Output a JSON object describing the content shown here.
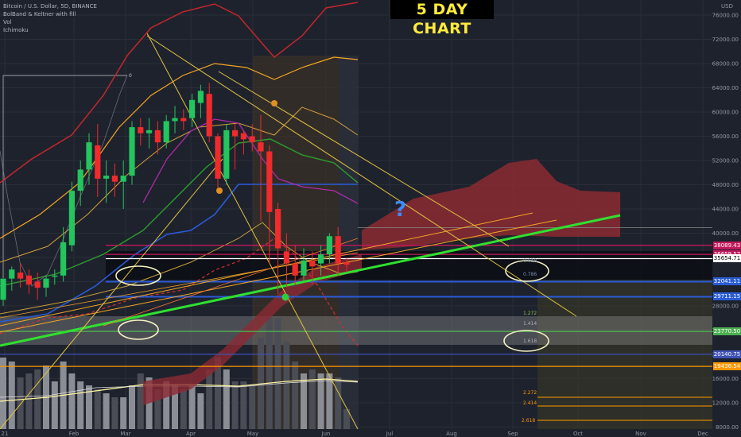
{
  "legend": {
    "symbol": "Bitcoin / U.S. Dollar, 5D, BINANCE",
    "ind1": "BolBand & Keltner with fill",
    "ind2": "Vol",
    "ind3": "Ichimoku"
  },
  "badge": "5 DAY CHART",
  "colors": {
    "background": "#1e222d",
    "up": "#22c55e",
    "down": "#ef2b2b",
    "trendline": "#30e030",
    "bb_outer": "#c2272d",
    "keltner": "#f5a623",
    "ichimoku_cloud": "#8b2a33",
    "kijun": "#2a5bd7",
    "tenkan": "#b02aa8"
  },
  "chart_data": {
    "type": "candlestick",
    "title": "5 DAY CHART",
    "y_axis": {
      "label": "USD",
      "ticks": [
        76000,
        72000,
        68000,
        64000,
        60000,
        56000,
        52000,
        48000,
        44000,
        40000,
        36000,
        32000,
        28000,
        24000,
        20000,
        16000,
        12000,
        8000
      ],
      "ylim": [
        7000,
        78500
      ]
    },
    "x_axis": {
      "ticks": [
        "21",
        "Feb",
        "Mar",
        "Apr",
        "May",
        "Jun",
        "Jul",
        "Aug",
        "Sep",
        "Oct",
        "Nov",
        "Dec"
      ]
    },
    "candles": [
      {
        "o": 29000,
        "h": 32000,
        "c": 32500,
        "l": 28000
      },
      {
        "o": 32500,
        "h": 34500,
        "c": 34000,
        "l": 30500
      },
      {
        "o": 33500,
        "h": 35000,
        "c": 32500,
        "l": 31000
      },
      {
        "o": 33000,
        "h": 34000,
        "c": 31500,
        "l": 30000
      },
      {
        "o": 32000,
        "h": 33500,
        "c": 31000,
        "l": 29000
      },
      {
        "o": 31000,
        "h": 33000,
        "c": 32500,
        "l": 29500
      },
      {
        "o": 32800,
        "h": 34000,
        "c": 33000,
        "l": 31500
      },
      {
        "o": 33000,
        "h": 41000,
        "c": 38500,
        "l": 32000
      },
      {
        "o": 38000,
        "h": 48500,
        "c": 47000,
        "l": 37000
      },
      {
        "o": 47000,
        "h": 52000,
        "c": 50500,
        "l": 44500
      },
      {
        "o": 50500,
        "h": 56500,
        "c": 55000,
        "l": 48000
      },
      {
        "o": 54500,
        "h": 58000,
        "c": 49000,
        "l": 46000
      },
      {
        "o": 49000,
        "h": 52000,
        "c": 49500,
        "l": 45000
      },
      {
        "o": 49500,
        "h": 51500,
        "c": 48500,
        "l": 46000
      },
      {
        "o": 48500,
        "h": 52000,
        "c": 49500,
        "l": 44000
      },
      {
        "o": 49500,
        "h": 58500,
        "c": 57500,
        "l": 48000
      },
      {
        "o": 57500,
        "h": 59000,
        "c": 56500,
        "l": 54500
      },
      {
        "o": 56500,
        "h": 59000,
        "c": 57000,
        "l": 54000
      },
      {
        "o": 57000,
        "h": 58500,
        "c": 55000,
        "l": 53000
      },
      {
        "o": 55000,
        "h": 59500,
        "c": 58500,
        "l": 54000
      },
      {
        "o": 58500,
        "h": 61000,
        "c": 59000,
        "l": 56500
      },
      {
        "o": 59000,
        "h": 60500,
        "c": 58500,
        "l": 57000
      },
      {
        "o": 59000,
        "h": 63000,
        "c": 62000,
        "l": 57500
      },
      {
        "o": 61500,
        "h": 64500,
        "c": 63500,
        "l": 59000
      },
      {
        "o": 63000,
        "h": 64800,
        "c": 56000,
        "l": 55000
      },
      {
        "o": 56000,
        "h": 56500,
        "c": 49000,
        "l": 47000
      },
      {
        "o": 49000,
        "h": 58000,
        "c": 57000,
        "l": 48000
      },
      {
        "o": 57000,
        "h": 58000,
        "c": 56000,
        "l": 50500
      },
      {
        "o": 56500,
        "h": 57000,
        "c": 55500,
        "l": 53000
      },
      {
        "o": 56000,
        "h": 58000,
        "c": 55000,
        "l": 53500
      },
      {
        "o": 55000,
        "h": 59500,
        "c": 53500,
        "l": 42000
      },
      {
        "o": 53500,
        "h": 54500,
        "c": 43500,
        "l": 35000
      },
      {
        "o": 44000,
        "h": 45000,
        "c": 37500,
        "l": 30000
      },
      {
        "o": 37000,
        "h": 40000,
        "c": 35000,
        "l": 31000
      },
      {
        "o": 35000,
        "h": 38000,
        "c": 33000,
        "l": 31500
      },
      {
        "o": 33000,
        "h": 37500,
        "c": 35500,
        "l": 32000
      },
      {
        "o": 35500,
        "h": 37000,
        "c": 34500,
        "l": 31500
      },
      {
        "o": 35000,
        "h": 38000,
        "c": 36500,
        "l": 33000
      },
      {
        "o": 36500,
        "h": 40000,
        "c": 39500,
        "l": 35000
      },
      {
        "o": 39500,
        "h": 41000,
        "c": 35000,
        "l": 33000
      },
      {
        "o": 35200,
        "h": 36000,
        "c": 34800,
        "l": 33500
      }
    ],
    "horizontal_levels": [
      {
        "value": 38000,
        "color": "#c2185b",
        "tag": "38089.43"
      },
      {
        "value": 36500,
        "color": "#c2185b",
        "tag": "36659.57"
      },
      {
        "value": 35800,
        "color": "#ffffff",
        "tag": "35654.71"
      },
      {
        "value": 32000,
        "color": "#2a5bd7",
        "tag": "32041.11"
      },
      {
        "value": 29500,
        "color": "#2a5bd7",
        "tag": "29711.15"
      },
      {
        "value": 23770,
        "color": "#4caf50",
        "tag": "23770.50"
      },
      {
        "value": 20000,
        "color": "#3f51b5",
        "tag": "20140.75"
      },
      {
        "value": 18000,
        "color": "#ff9800",
        "tag": "19436.54"
      }
    ],
    "fib_labels": [
      "0",
      "1.272",
      "1.414",
      "1.618",
      "2.272",
      "2.414",
      "2.618",
      "0.618",
      "0.786"
    ],
    "annotations": [
      "?"
    ]
  }
}
